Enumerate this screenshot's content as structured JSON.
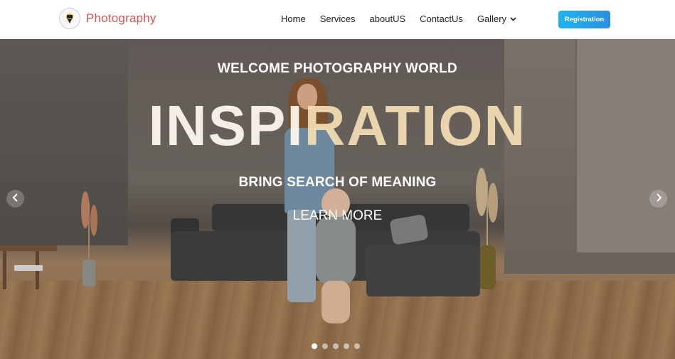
{
  "brand": {
    "name": "Photography",
    "logo_icon": "camera-person-icon",
    "color": "#d9534f"
  },
  "nav": {
    "links": [
      "Home",
      "Services",
      "aboutUS",
      "ContactUs"
    ],
    "gallery_label": "Gallery",
    "gallery_icon": "chevron-down-icon"
  },
  "registration": {
    "label": "Registration",
    "color": "#1db3f0"
  },
  "hero": {
    "welcome": "WELCOME PHOTOGRAPHY WORLD",
    "big_part1": "INSPI",
    "big_part2": "RATION",
    "subtitle": "BRING SEARCH OF MEANING",
    "button": "LEARN MORE",
    "prev_icon": "chevron-left-icon",
    "next_icon": "chevron-right-icon",
    "slides": 5,
    "active_slide": 1
  }
}
